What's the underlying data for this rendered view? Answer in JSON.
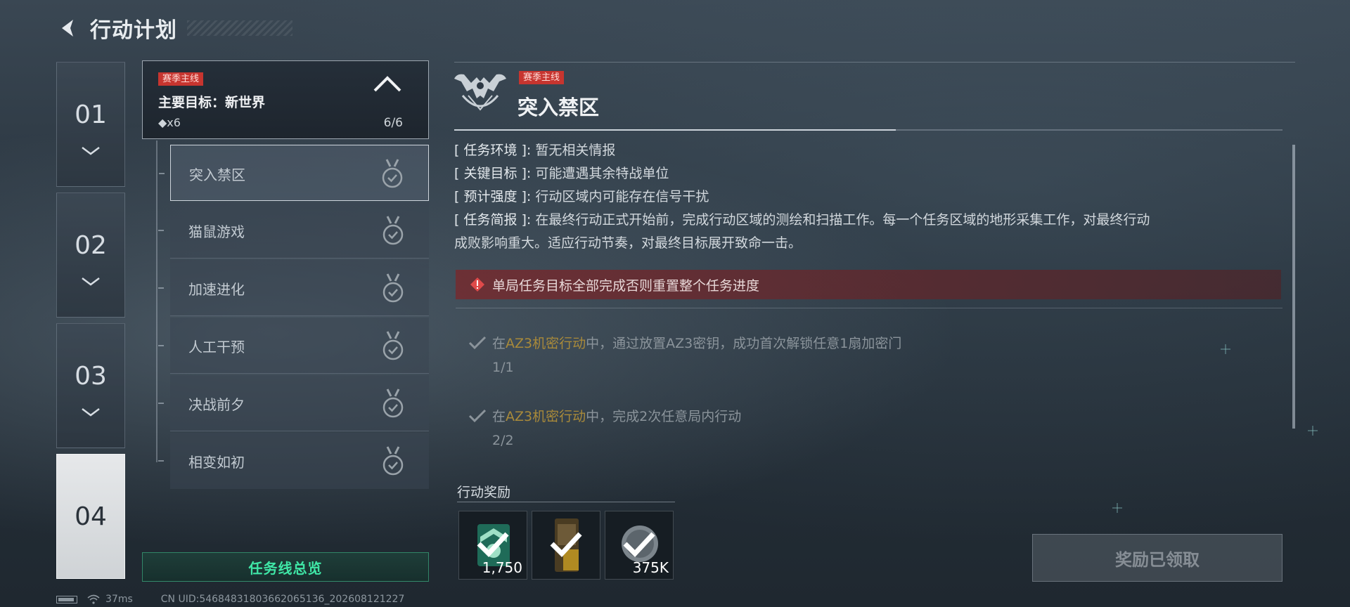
{
  "header": {
    "title": "行动计划",
    "back_icon": "back-arrow-icon"
  },
  "chapters": [
    {
      "label": "01",
      "active": false
    },
    {
      "label": "02",
      "active": false
    },
    {
      "label": "03",
      "active": false
    },
    {
      "label": "04",
      "active": true
    }
  ],
  "objective": {
    "tag": "赛季主线",
    "title": "主要目标：新世界",
    "count": "◆x6",
    "progress": "6/6"
  },
  "missions": [
    {
      "label": "突入禁区",
      "selected": true
    },
    {
      "label": "猫鼠游戏",
      "selected": false
    },
    {
      "label": "加速进化",
      "selected": false
    },
    {
      "label": "人工干预",
      "selected": false
    },
    {
      "label": "决战前夕",
      "selected": false
    },
    {
      "label": "相变如初",
      "selected": false
    }
  ],
  "overview_button": "任务线总览",
  "detail": {
    "tag": "赛季主线",
    "title": "突入禁区",
    "info": [
      {
        "key": "[ 任务环境 ]:",
        "value": "暂无相关情报"
      },
      {
        "key": "[ 关键目标 ]:",
        "value": "可能遭遇其余特战单位"
      },
      {
        "key": "[ 预计强度 ]:",
        "value": "行动区域内可能存在信号干扰"
      },
      {
        "key": "[ 任务简报 ]:",
        "value": "在最终行动正式开始前，完成行动区域的测绘和扫描工作。每一个任务区域的地形采集工作，对最终行动"
      }
    ],
    "brief_cont": "成败影响重大。适应行动节奏，对最终目标展开致命一击。",
    "warning": "单局任务目标全部完成否则重置整个任务进度",
    "tasks": [
      {
        "pre": "在",
        "highlight": "AZ3机密行动",
        "post": "中，通过放置AZ3密钥，成功首次解锁任意1扇加密门",
        "progress": "1/1"
      },
      {
        "pre": "在",
        "highlight": "AZ3机密行动",
        "post": "中，完成2次任意局内行动",
        "progress": "2/2"
      }
    ]
  },
  "rewards": {
    "label": "行动奖励",
    "items": [
      {
        "icon": "badge-reward-icon",
        "qty": "1,750"
      },
      {
        "icon": "gear-pack-reward-icon",
        "qty": ""
      },
      {
        "icon": "coin-reward-icon",
        "qty": "375K"
      }
    ],
    "claim_button": "奖励已领取"
  },
  "status": {
    "ping": "37ms",
    "uid": "CN UID:5468483180366206513​6_202608121227"
  },
  "colors": {
    "accent_green": "#3fe6a6",
    "tag_red": "#c7352f",
    "highlight_gold": "#a98a3a"
  }
}
